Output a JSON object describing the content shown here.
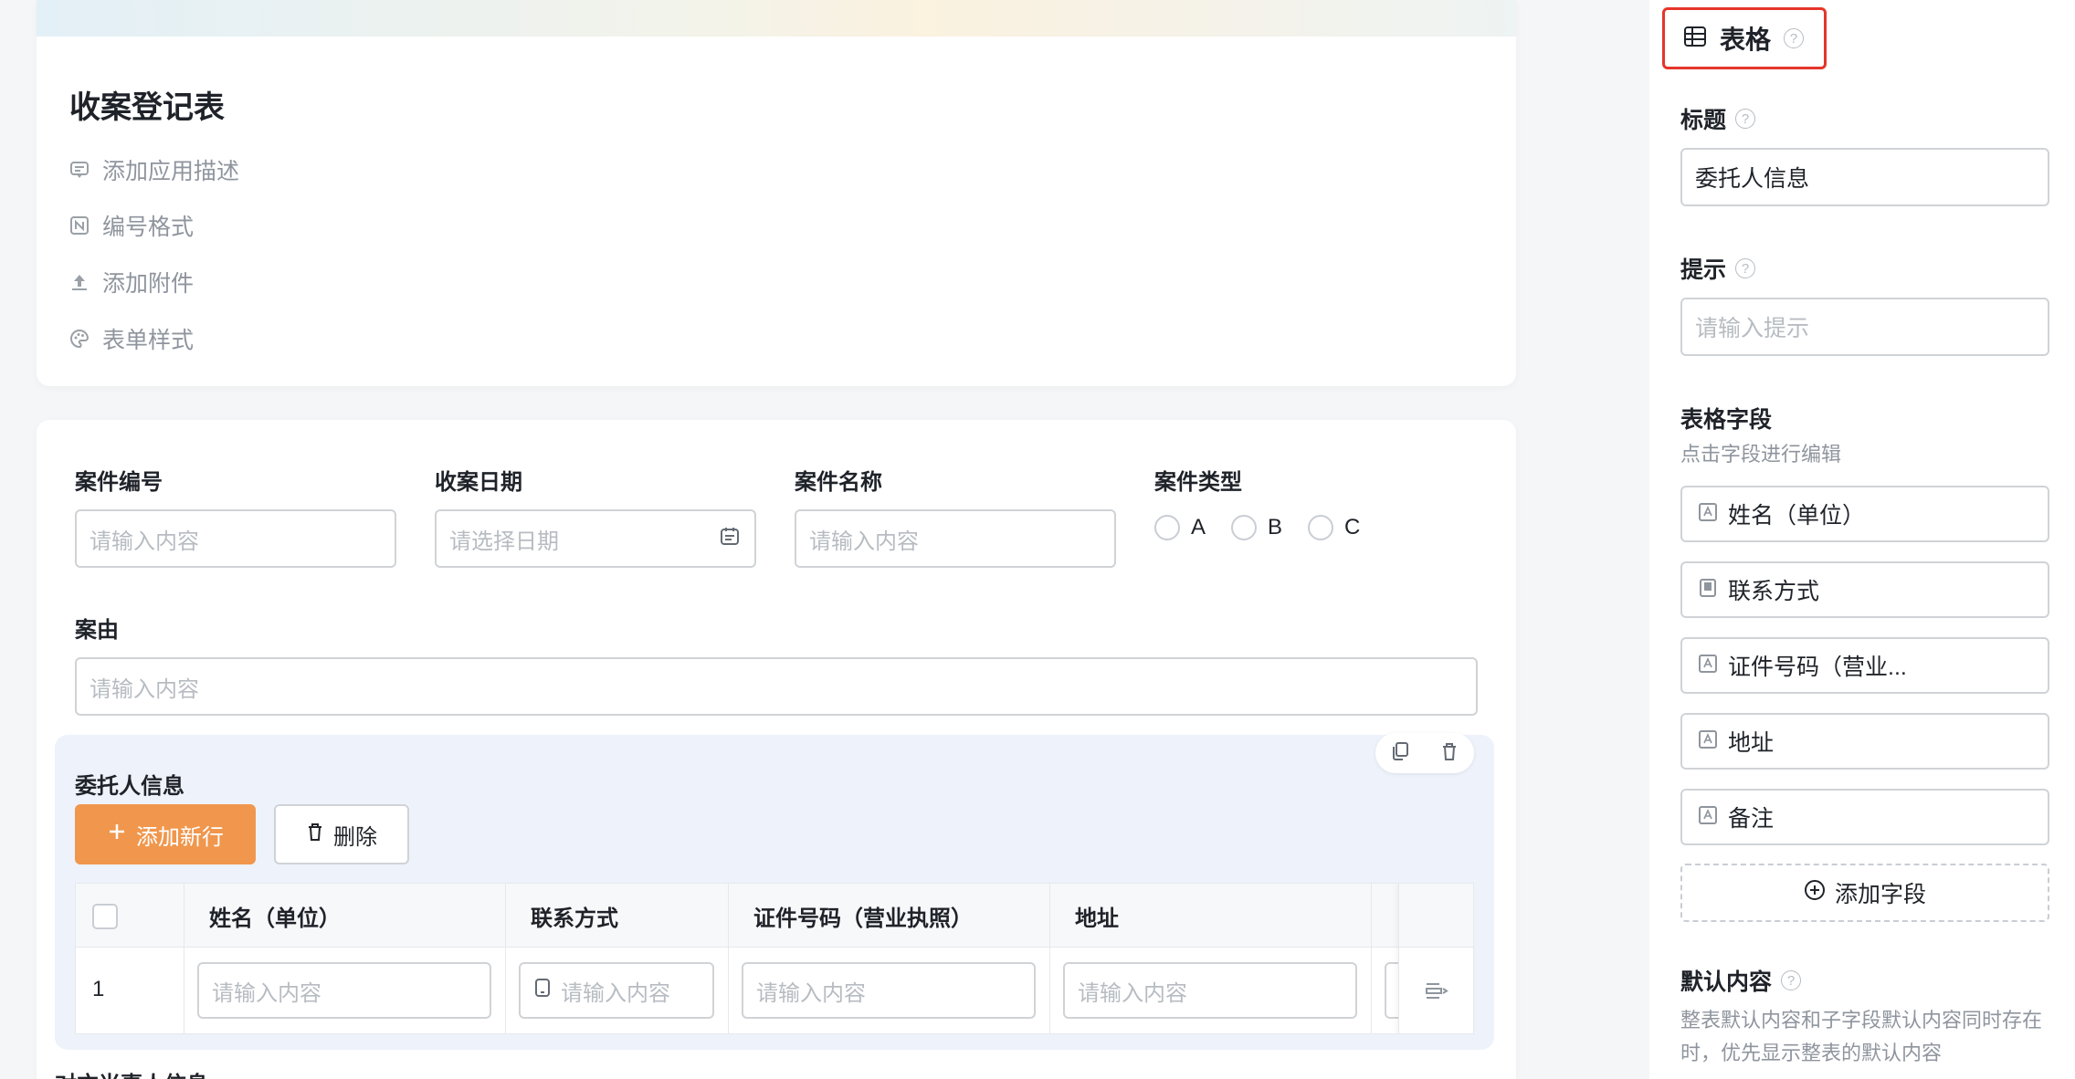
{
  "form": {
    "title": "收案登记表",
    "meta": [
      {
        "label": "添加应用描述",
        "icon": "comment-icon"
      },
      {
        "label": "编号格式",
        "icon": "number-format-icon"
      },
      {
        "label": "添加附件",
        "icon": "upload-icon"
      },
      {
        "label": "表单样式",
        "icon": "palette-icon"
      }
    ]
  },
  "fields": {
    "case_no": {
      "label": "案件编号",
      "placeholder": "请输入内容"
    },
    "date": {
      "label": "收案日期",
      "placeholder": "请选择日期"
    },
    "case_name": {
      "label": "案件名称",
      "placeholder": "请输入内容"
    },
    "case_type": {
      "label": "案件类型",
      "options": [
        "A",
        "B",
        "C"
      ]
    },
    "cause": {
      "label": "案由",
      "placeholder": "请输入内容"
    }
  },
  "subtable": {
    "title": "委托人信息",
    "add_row": "添加新行",
    "delete": "删除",
    "columns": [
      "姓名（单位）",
      "联系方式",
      "证件号码（营业执照）",
      "地址"
    ],
    "row_number": "1",
    "cell_placeholder": "请输入内容"
  },
  "next_section": "对方当事人信息",
  "panel": {
    "header": "表格",
    "title_label": "标题",
    "title_value": "委托人信息",
    "hint_label": "提示",
    "hint_placeholder": "请输入提示",
    "fields_label": "表格字段",
    "fields_hint": "点击字段进行编辑",
    "fields": [
      "姓名（单位）",
      "联系方式",
      "证件号码（营业...",
      "地址",
      "备注"
    ],
    "add_field": "添加字段",
    "default_label": "默认内容",
    "default_hint": "整表默认内容和子字段默认内容同时存在时，优先显示整表的默认内容"
  },
  "colors": {
    "accent": "#f0974d",
    "highlight": "#e5352b",
    "subtable_bg": "#eef2fb"
  }
}
